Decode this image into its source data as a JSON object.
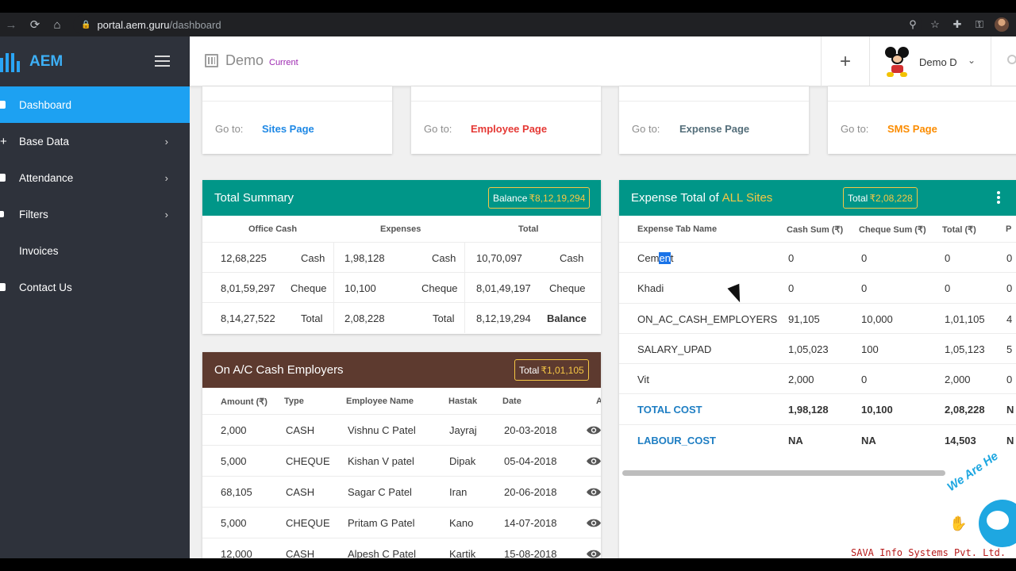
{
  "browser": {
    "url_host": "portal.aem.guru",
    "url_path": "/dashboard"
  },
  "sidebar": {
    "brand": "AEM",
    "items": [
      {
        "label": "Dashboard",
        "active": true
      },
      {
        "label": "Base Data",
        "has_submenu": true
      },
      {
        "label": "Attendance",
        "has_submenu": true
      },
      {
        "label": "Filters",
        "has_submenu": true
      },
      {
        "label": "Invoices"
      },
      {
        "label": "Contact Us"
      }
    ]
  },
  "header": {
    "title": "Demo",
    "current": "Current",
    "user": "Demo D",
    "add_icon": "+"
  },
  "goto_cards": [
    {
      "label": "Go to:",
      "link": "Sites Page",
      "color": "#1e88e5"
    },
    {
      "label": "Go to:",
      "link": "Employee Page",
      "color": "#e53935"
    },
    {
      "label": "Go to:",
      "link": "Expense Page",
      "color": "#546e7a"
    },
    {
      "label": "Go to:",
      "link": "SMS Page",
      "color": "#fb8c00"
    }
  ],
  "summary": {
    "title": "Total Summary",
    "badge_label": "Balance",
    "badge_value": "₹8,12,19,294",
    "header_color": "#009688",
    "columns": [
      "Office Cash",
      "Expenses",
      "Total"
    ],
    "rows": [
      [
        "12,68,225",
        "Cash",
        "1,98,128",
        "Cash",
        "10,70,097",
        "Cash"
      ],
      [
        "8,01,59,297",
        "Cheque",
        "10,100",
        "Cheque",
        "8,01,49,197",
        "Cheque"
      ],
      [
        "8,14,27,522",
        "Total",
        "2,08,228",
        "Total",
        "8,12,19,294",
        "Balance"
      ]
    ]
  },
  "expense": {
    "title_prefix": "Expense Total of",
    "title_highlight": "ALL Sites",
    "badge_label": "Total",
    "badge_value": "₹2,08,228",
    "header_color": "#009688",
    "columns": [
      "Expense Tab Name",
      "Cash Sum (₹)",
      "Cheque Sum (₹)",
      "Total (₹)",
      "P"
    ],
    "rows": [
      {
        "name_a": "Cem",
        "name_sel": "en",
        "name_b": "t",
        "cash": "0",
        "cheque": "0",
        "total": "0",
        "p": "0"
      },
      {
        "name": "Khadi",
        "cash": "0",
        "cheque": "0",
        "total": "0",
        "p": "0"
      },
      {
        "name": "ON_AC_CASH_EMPLOYERS",
        "cash": "91,105",
        "cheque": "10,000",
        "total": "1,01,105",
        "p": "4"
      },
      {
        "name": "SALARY_UPAD",
        "cash": "1,05,023",
        "cheque": "100",
        "total": "1,05,123",
        "p": "5"
      },
      {
        "name": "Vit",
        "cash": "2,000",
        "cheque": "0",
        "total": "2,000",
        "p": "0"
      },
      {
        "name": "TOTAL COST",
        "cash": "1,98,128",
        "cheque": "10,100",
        "total": "2,08,228",
        "p": "N"
      },
      {
        "name": "LABOUR_COST",
        "cash": "NA",
        "cheque": "NA",
        "total": "14,503",
        "p": "N"
      }
    ]
  },
  "employers": {
    "title": "On A/C Cash Employers",
    "badge_label": "Total",
    "badge_value": "₹1,01,105",
    "header_color": "#5d3a2f",
    "columns": [
      "Amount (₹)",
      "Type",
      "Employee Name",
      "Hastak",
      "Date",
      "A"
    ],
    "rows": [
      [
        "2,000",
        "CASH",
        "Vishnu C Patel",
        "Jayraj",
        "20-03-2018"
      ],
      [
        "5,000",
        "CHEQUE",
        "Kishan V patel",
        "Dipak",
        "05-04-2018"
      ],
      [
        "68,105",
        "CASH",
        "Sagar C Patel",
        "Iran",
        "20-06-2018"
      ],
      [
        "5,000",
        "CHEQUE",
        "Pritam G Patel",
        "Kano",
        "14-07-2018"
      ],
      [
        "12,000",
        "CASH",
        "Alpesh C Patel",
        "Kartik",
        "15-08-2018"
      ]
    ]
  },
  "chat": {
    "tagline": "We Are He",
    "company": "SAVA Info Systems Pvt. Ltd."
  }
}
